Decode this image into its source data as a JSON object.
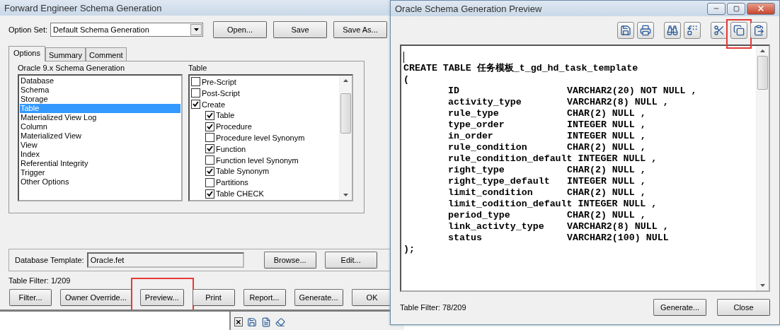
{
  "main_window": {
    "title": "Forward Engineer Schema Generation",
    "option_set": {
      "label": "Option Set:",
      "value": "Default Schema Generation"
    },
    "top_buttons": [
      {
        "label": "Open..."
      },
      {
        "label": "Save"
      },
      {
        "label": "Save As..."
      }
    ],
    "tabs": [
      {
        "label": "Options",
        "selected": true
      },
      {
        "label": "Summary",
        "selected": false
      },
      {
        "label": "Comment",
        "selected": false
      }
    ],
    "categories": {
      "heading": "Oracle 9.x Schema Generation",
      "items": [
        {
          "label": "Database",
          "selected": false
        },
        {
          "label": "Schema",
          "selected": false
        },
        {
          "label": "Storage",
          "selected": false
        },
        {
          "label": "Table",
          "selected": true
        },
        {
          "label": "Materialized View Log",
          "selected": false
        },
        {
          "label": "Column",
          "selected": false
        },
        {
          "label": "Materialized View",
          "selected": false
        },
        {
          "label": "View",
          "selected": false
        },
        {
          "label": "Index",
          "selected": false
        },
        {
          "label": "Referential Integrity",
          "selected": false
        },
        {
          "label": "Trigger",
          "selected": false
        },
        {
          "label": "Other Options",
          "selected": false
        }
      ]
    },
    "options": {
      "heading": "Table",
      "items": [
        {
          "label": "Pre-Script",
          "checked": false
        },
        {
          "label": "Post-Script",
          "checked": false
        },
        {
          "label": "Create",
          "checked": true,
          "children": [
            {
              "label": "Table",
              "checked": true
            },
            {
              "label": "Procedure",
              "checked": true
            },
            {
              "label": "Procedure level Synonym",
              "checked": false
            },
            {
              "label": "Function",
              "checked": true
            },
            {
              "label": "Function level Synonym",
              "checked": false
            },
            {
              "label": "Table Synonym",
              "checked": true
            },
            {
              "label": "Partitions",
              "checked": false
            },
            {
              "label": "Table CHECK",
              "checked": true
            }
          ]
        }
      ]
    },
    "database_template": {
      "label": "Database Template:",
      "value": "Oracle.fet",
      "buttons": [
        {
          "label": "Browse..."
        },
        {
          "label": "Edit..."
        }
      ]
    },
    "table_filter": "Table Filter: 1/209",
    "bottom_buttons": [
      {
        "label": "Filter...",
        "highlighted": false
      },
      {
        "label": "Owner Override...",
        "highlighted": false
      },
      {
        "label": "Preview...",
        "highlighted": true
      },
      {
        "label": "Print",
        "highlighted": false
      },
      {
        "label": "Report...",
        "highlighted": false
      },
      {
        "label": "Generate...",
        "highlighted": false
      },
      {
        "label": "OK",
        "highlighted": false
      }
    ]
  },
  "background_toolbar": {
    "close_glyph": "×",
    "icons": [
      {
        "kind": "save"
      },
      {
        "kind": "document"
      },
      {
        "kind": "eraser"
      }
    ]
  },
  "preview_window": {
    "title": "Oracle Schema Generation Preview",
    "toolbar": [
      {
        "kind": "save",
        "highlighted": false
      },
      {
        "kind": "print",
        "highlighted": false
      },
      {
        "kind": "find",
        "highlighted": false
      },
      {
        "kind": "replace",
        "highlighted": false
      },
      {
        "kind": "cut",
        "highlighted": false
      },
      {
        "kind": "copy",
        "highlighted": true
      },
      {
        "kind": "paste",
        "highlighted": false
      }
    ],
    "code": {
      "header": "CREATE TABLE 任务模板_t_gd_hd_task_template",
      "open": "(",
      "columns": [
        {
          "name": "ID",
          "definition": "VARCHAR2(20) NOT NULL ,"
        },
        {
          "name": "activity_type",
          "definition": "VARCHAR2(8) NULL ,"
        },
        {
          "name": "rule_type",
          "definition": "CHAR(2) NULL ,"
        },
        {
          "name": "type_order",
          "definition": "INTEGER NULL ,"
        },
        {
          "name": "in_order",
          "definition": "INTEGER NULL ,"
        },
        {
          "name": "rule_condition",
          "definition": "CHAR(2) NULL ,"
        },
        {
          "name": "rule_condition_default",
          "definition": "INTEGER NULL ,"
        },
        {
          "name": "right_type",
          "definition": "CHAR(2) NULL ,"
        },
        {
          "name": "right_type_default",
          "definition": "INTEGER NULL ,"
        },
        {
          "name": "limit_condition",
          "definition": "CHAR(2) NULL ,"
        },
        {
          "name": "limit_codition_default",
          "definition": "INTEGER NULL ,"
        },
        {
          "name": "period_type",
          "definition": "CHAR(2) NULL ,"
        },
        {
          "name": "link_activty_type",
          "definition": "VARCHAR2(8) NULL ,"
        },
        {
          "name": "status",
          "definition": "VARCHAR2(100) NULL"
        }
      ],
      "close": ");"
    },
    "table_filter": "Table Filter: 78/209",
    "buttons": [
      {
        "label": "Generate..."
      },
      {
        "label": "Close"
      }
    ]
  }
}
